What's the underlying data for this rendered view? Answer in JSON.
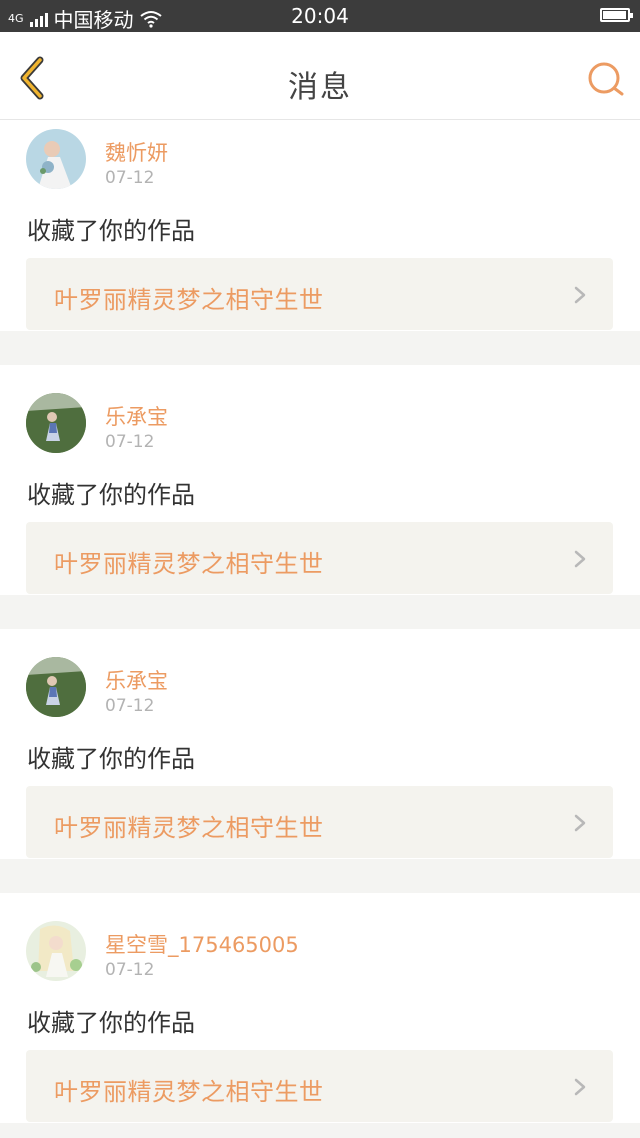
{
  "status_bar": {
    "signal": "4G",
    "carrier": "中国移动",
    "time": "20:04",
    "battery_level": 0.95
  },
  "nav": {
    "title": "消息",
    "back_icon": "chevron-left-icon",
    "search_icon": "search-icon"
  },
  "colors": {
    "accent": "#ec9b62",
    "back_arrow": "#f0b42f",
    "card_link_bg": "#f4f3ee"
  },
  "messages": [
    {
      "username": "魏忻妍",
      "date": "07-12",
      "action": "收藏了你的作品",
      "work_title": "叶罗丽精灵梦之相守生世"
    },
    {
      "username": "乐承宝",
      "date": "07-12",
      "action": "收藏了你的作品",
      "work_title": "叶罗丽精灵梦之相守生世"
    },
    {
      "username": "乐承宝",
      "date": "07-12",
      "action": "收藏了你的作品",
      "work_title": "叶罗丽精灵梦之相守生世"
    },
    {
      "username": "星空雪_175465005",
      "date": "07-12",
      "action": "收藏了你的作品",
      "work_title": "叶罗丽精灵梦之相守生世"
    }
  ]
}
